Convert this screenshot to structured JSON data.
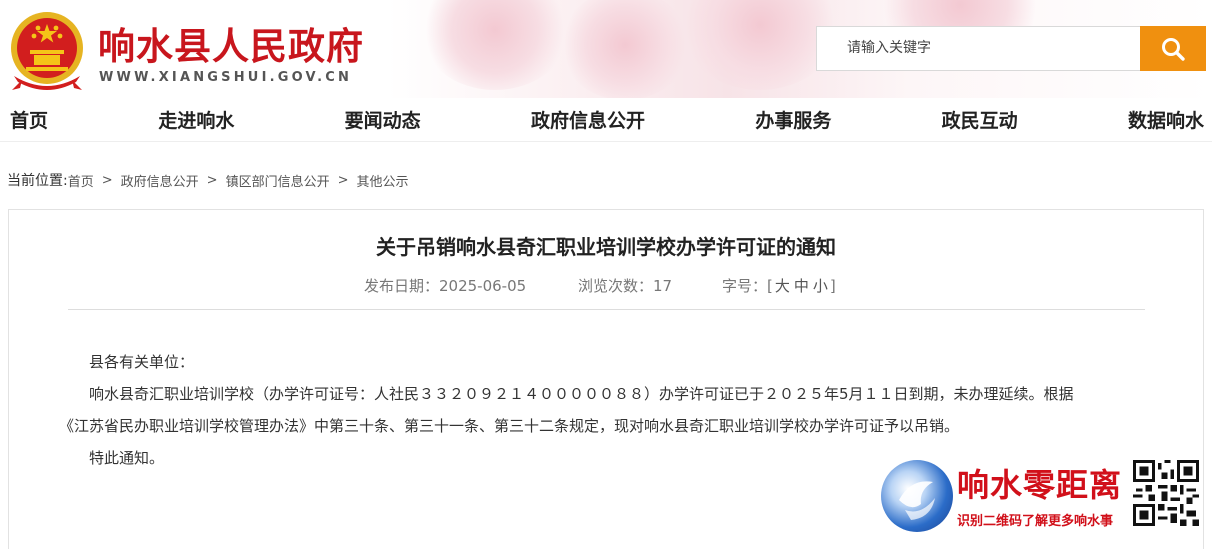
{
  "header": {
    "site_title": "响水县人民政府",
    "site_url": "WWW.XIANGSHUI.GOV.CN",
    "search_placeholder": "请输入关键字",
    "emblem_icon": "national-emblem-icon",
    "search_icon": "search-icon",
    "accent_color": "#c8161d",
    "search_button_color": "#f0900f"
  },
  "nav": {
    "items": [
      "首页",
      "走进响水",
      "要闻动态",
      "政府信息公开",
      "办事服务",
      "政民互动",
      "数据响水"
    ]
  },
  "breadcrumb": {
    "lead": "当前位置:",
    "items": [
      "首页",
      "政府信息公开",
      "镇区部门信息公开",
      "其他公示"
    ],
    "separator": ">"
  },
  "article": {
    "title": "关于吊销响水县奇汇职业培训学校办学许可证的通知",
    "date_label": "发布日期：2025-06-05",
    "views_label": "浏览次数：17",
    "font_size_prefix": "字号：[",
    "font_sizes": [
      "大",
      "中",
      "小"
    ],
    "font_size_suffix": "]",
    "salutation": "县各有关单位：",
    "paragraph_1": "响水县奇汇职业培训学校（办学许可证号：人社民３３２０９２１４０００００８８）办学许可证已于２０２５年5月１１日到期，未办理延续。根据",
    "paragraph_2": "《江苏省民办职业培训学校管理办法》中第三十条、第三十一条、第三十二条规定，现对响水县奇汇职业培训学校办学许可证予以吊销。",
    "closing": "特此通知。"
  },
  "watermark": {
    "title": "响水零距离",
    "subtitle": "识别二维码了解更多响水事",
    "logo_icon": "xiangshui-logo-icon",
    "qr_icon": "qr-code-icon"
  }
}
